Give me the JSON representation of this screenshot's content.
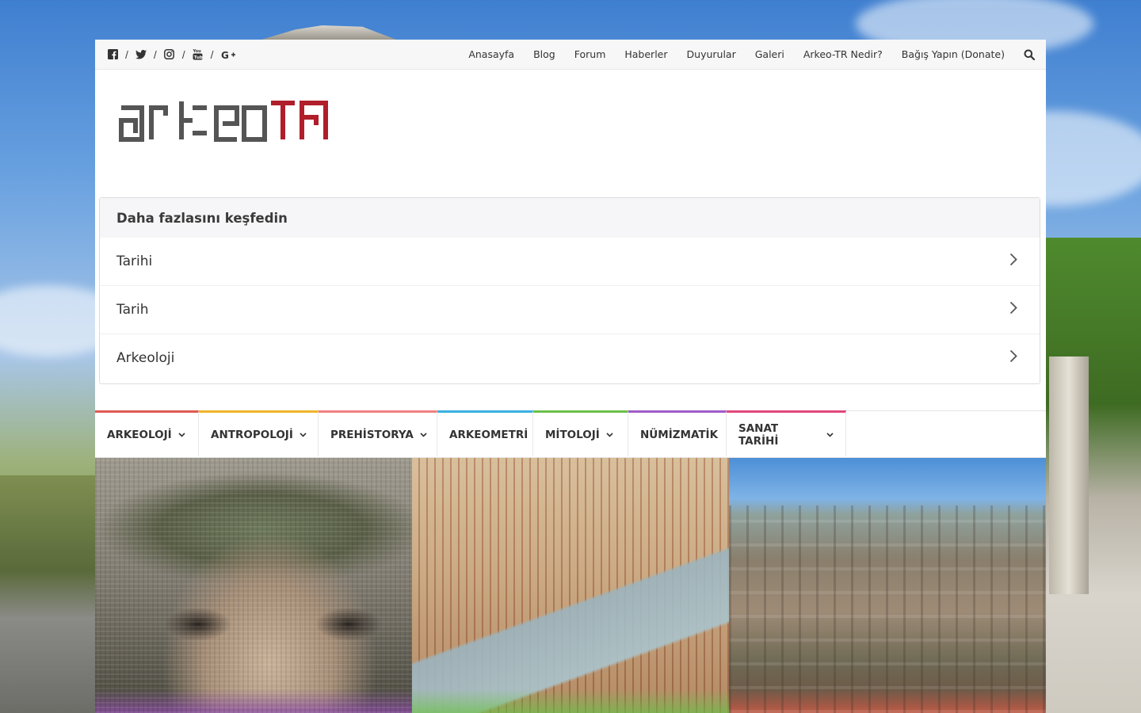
{
  "social": {
    "icons": [
      "facebook-icon",
      "twitter-icon",
      "instagram-icon",
      "youtube-icon",
      "google-plus-icon"
    ],
    "separator": "/"
  },
  "topnav": {
    "items": [
      "Anasayfa",
      "Blog",
      "Forum",
      "Haberler",
      "Duyurular",
      "Galeri",
      "Arkeo-TR Nedir?",
      "Bağış Yapın (Donate)"
    ]
  },
  "logo": {
    "text": "ARKEOTR",
    "colors": {
      "primary": "#555555",
      "accent": "#b01e2a"
    }
  },
  "explore": {
    "title": "Daha fazlasını keşfedin",
    "items": [
      "Tarihi",
      "Tarih",
      "Arkeoloji"
    ]
  },
  "categories": [
    {
      "label": "ARKEOLOJİ",
      "color": "#e05a52",
      "dropdown": true
    },
    {
      "label": "ANTROPOLOJİ",
      "color": "#f0b429",
      "dropdown": true
    },
    {
      "label": "PREHİSTORYA",
      "color": "#f08080",
      "dropdown": true
    },
    {
      "label": "ARKEOMETRİ",
      "color": "#3ab0e0",
      "dropdown": false
    },
    {
      "label": "MİTOLOJİ",
      "color": "#6cc04a",
      "dropdown": true
    },
    {
      "label": "NÜMİZMATİK",
      "color": "#a05cc8",
      "dropdown": false
    },
    {
      "label": "SANAT TARİHİ",
      "color": "#e0487a",
      "dropdown": true
    }
  ],
  "thumbs": [
    {
      "subject": "mosaic-portrait",
      "fade": "#8e4fa8"
    },
    {
      "subject": "roman-villa-model",
      "fade": "#6cc04a"
    },
    {
      "subject": "ancient-ruins",
      "fade": "#e0604a"
    }
  ]
}
